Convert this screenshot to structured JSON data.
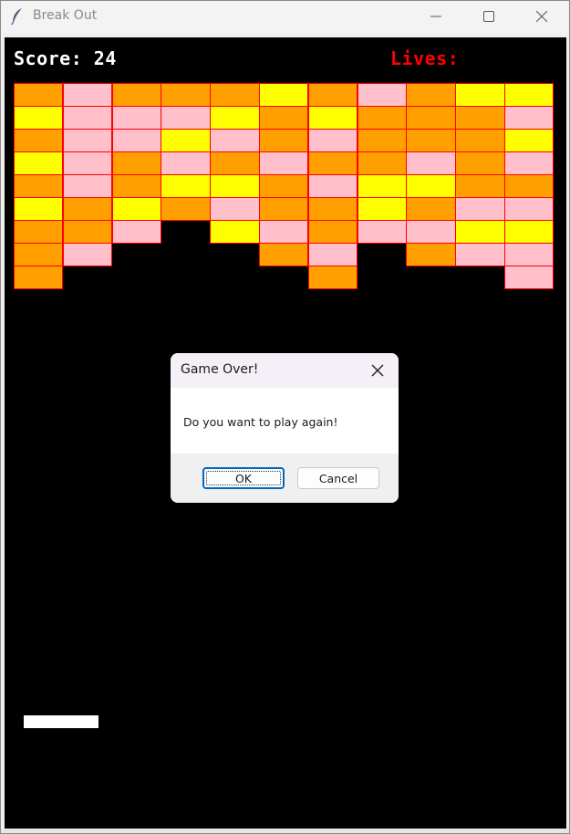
{
  "window": {
    "title": "Break Out",
    "icon": "feather-icon",
    "controls": [
      "minimize-icon",
      "maximize-icon",
      "close-icon"
    ]
  },
  "game": {
    "score_text": "Score: 24",
    "score": 24,
    "lives_text": "Lives:",
    "colors": {
      "background": "#000000",
      "score": "#ffffff",
      "lives": "#ff0000",
      "brick_border": "#ff0000",
      "paddle": "#ffffff",
      "O": "#ffa000",
      "P": "#ffc0cb",
      "Y": "#ffff00"
    },
    "brick_rows": [
      [
        "O",
        "P",
        "O",
        "O",
        "O",
        "Y",
        "O",
        "P",
        "O",
        "Y",
        "Y"
      ],
      [
        "Y",
        "P",
        "P",
        "P",
        "Y",
        "O",
        "Y",
        "O",
        "O",
        "O",
        "P"
      ],
      [
        "O",
        "P",
        "P",
        "Y",
        "P",
        "O",
        "P",
        "O",
        "O",
        "O",
        "Y"
      ],
      [
        "Y",
        "P",
        "O",
        "P",
        "O",
        "P",
        "O",
        "O",
        "P",
        "O",
        "P"
      ],
      [
        "O",
        "P",
        "O",
        "Y",
        "Y",
        "O",
        "P",
        "Y",
        "Y",
        "O",
        "O"
      ],
      [
        "Y",
        "O",
        "Y",
        "O",
        "P",
        "O",
        "O",
        "Y",
        "O",
        "P",
        "P"
      ],
      [
        "O",
        "O",
        "P",
        "",
        "Y",
        "P",
        "O",
        "P",
        "P",
        "Y",
        "Y"
      ],
      [
        "O",
        "P",
        "",
        "",
        "",
        "O",
        "P",
        "",
        "O",
        "P",
        "P"
      ],
      [
        "O",
        "",
        "",
        "",
        "",
        "",
        "O",
        "",
        "",
        "",
        "P"
      ]
    ]
  },
  "dialog": {
    "title": "Game Over!",
    "message": "Do you want to play again!",
    "ok_label": "OK",
    "cancel_label": "Cancel"
  }
}
